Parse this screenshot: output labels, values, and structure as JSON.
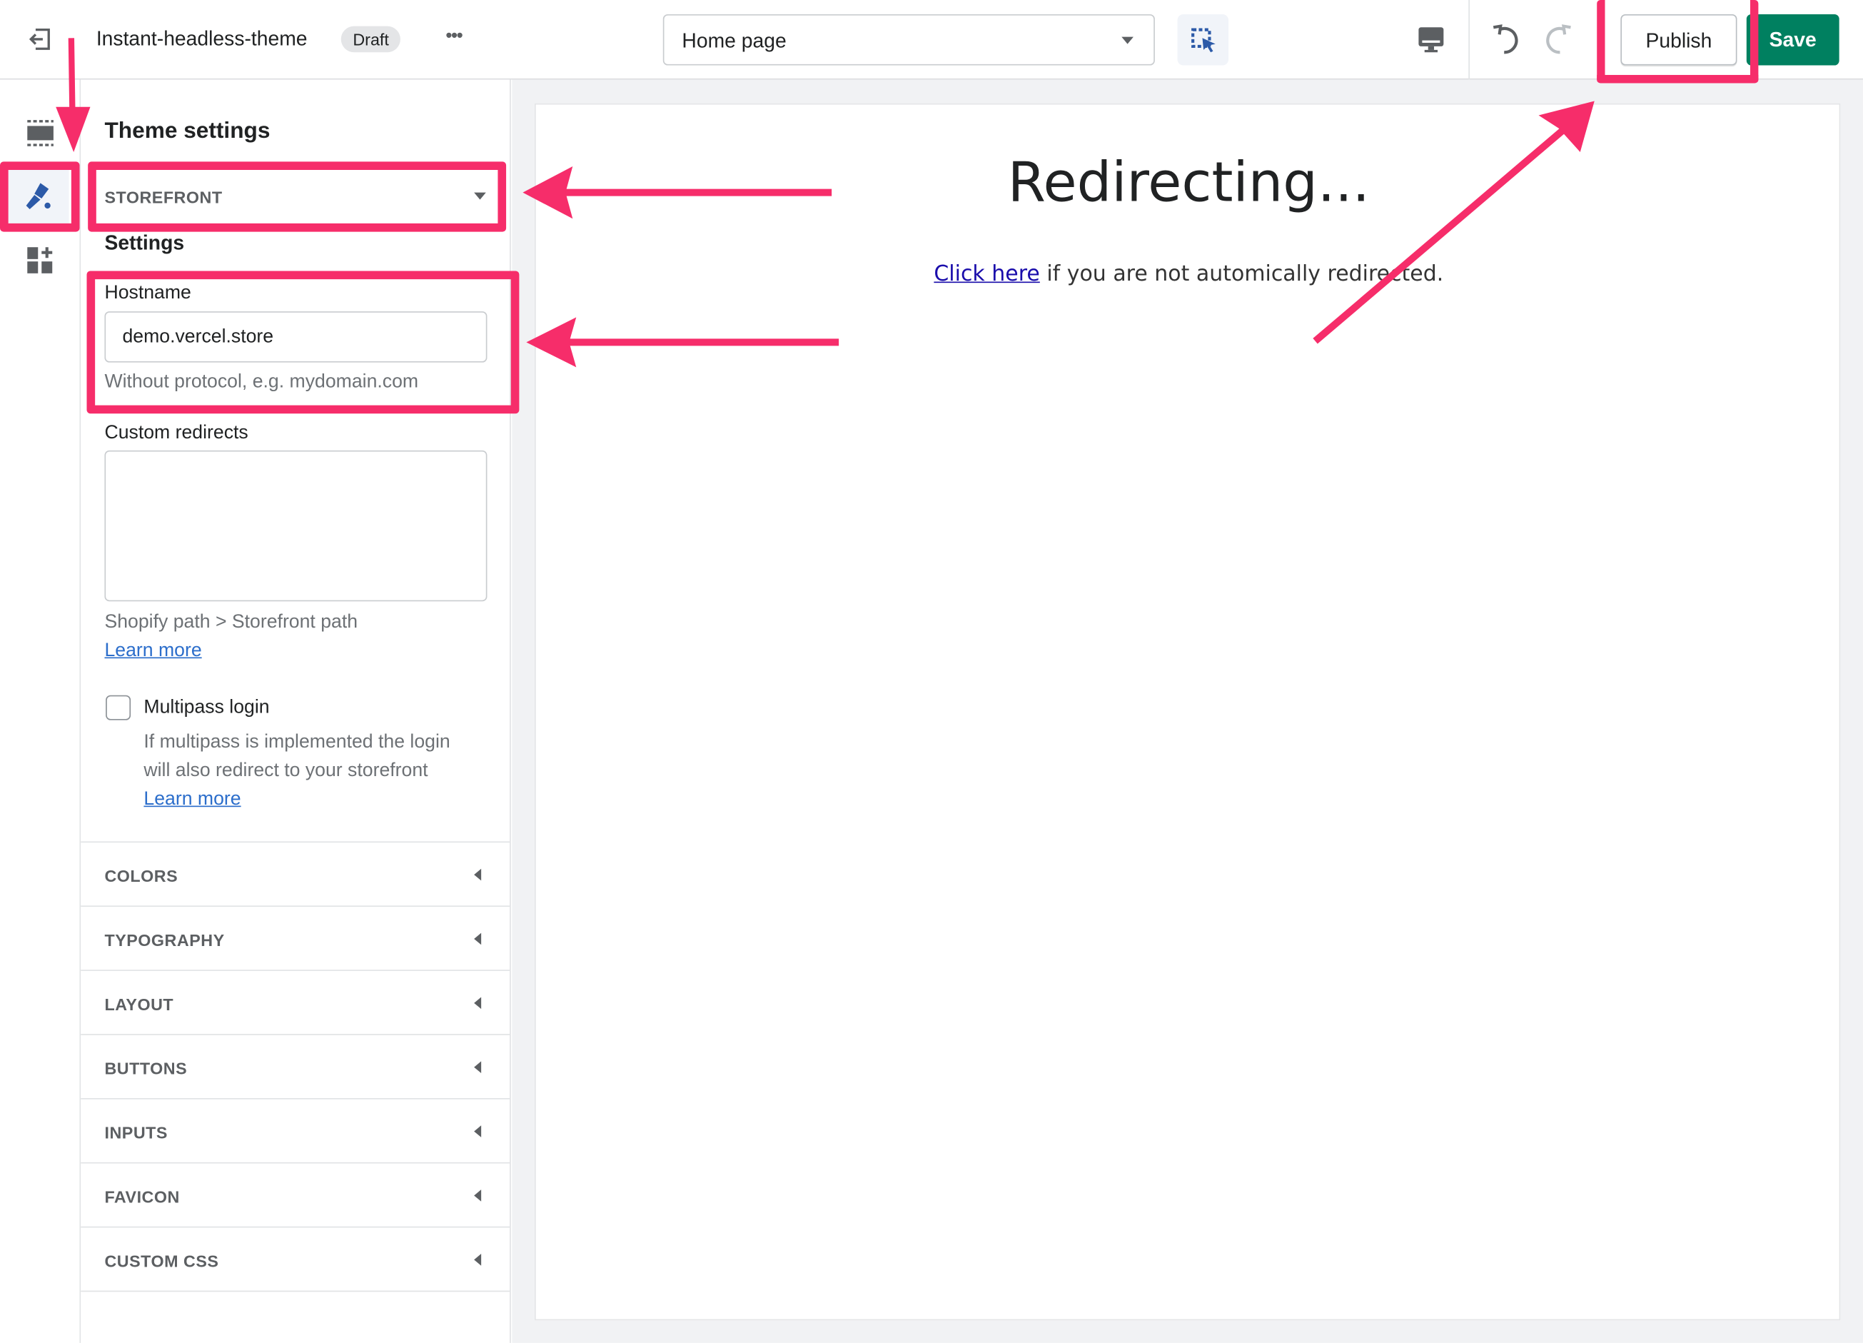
{
  "topbar": {
    "theme_name": "Instant-headless-theme",
    "status_badge": "Draft",
    "more_label": "•••",
    "page_select": "Home page",
    "publish_label": "Publish",
    "save_label": "Save"
  },
  "sidebar": {
    "title": "Theme settings",
    "open_section": "STOREFRONT",
    "settings_heading": "Settings",
    "hostname": {
      "label": "Hostname",
      "value": "demo.vercel.store",
      "help": "Without protocol, e.g. mydomain.com"
    },
    "custom_redirects": {
      "label": "Custom redirects",
      "value": "",
      "help": "Shopify path > Storefront path",
      "link": "Learn more"
    },
    "multipass": {
      "label": "Multipass login",
      "checked": false,
      "help_line1": "If multipass is implemented the login",
      "help_line2": "will also redirect to your storefront",
      "link": "Learn more"
    },
    "sections": [
      "COLORS",
      "TYPOGRAPHY",
      "LAYOUT",
      "BUTTONS",
      "INPUTS",
      "FAVICON",
      "CUSTOM CSS"
    ]
  },
  "preview": {
    "heading": "Redirecting...",
    "link": "Click here",
    "text": " if you are not automically redirected."
  },
  "colors": {
    "accent": "#f62d6a",
    "save": "#008060",
    "link_blue": "#2c6ecb"
  }
}
